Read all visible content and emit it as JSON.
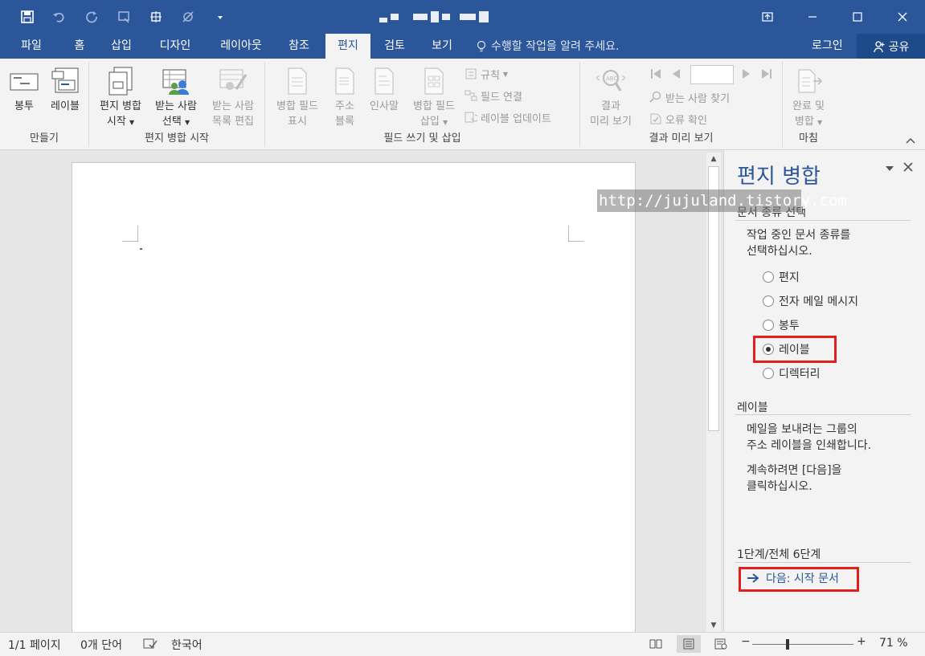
{
  "qat": {
    "icons": [
      "save-icon",
      "undo-icon",
      "redo-icon",
      "customize-icon",
      "print-icon",
      "format-painter-icon",
      "more-icon"
    ]
  },
  "tabs": [
    {
      "label": "파일"
    },
    {
      "label": "홈"
    },
    {
      "label": "삽입"
    },
    {
      "label": "디자인"
    },
    {
      "label": "레이아웃"
    },
    {
      "label": "참조"
    },
    {
      "label": "편지"
    },
    {
      "label": "검토"
    },
    {
      "label": "보기"
    }
  ],
  "tellme": "수행할 작업을 알려 주세요.",
  "login": "로그인",
  "share": "공유",
  "ribbon": {
    "create": {
      "label": "만들기",
      "envelope": "봉투",
      "labels": "레이블"
    },
    "start": {
      "label": "편지 병합 시작",
      "start_merge": [
        "편지 병합",
        "시작"
      ],
      "select_recipients": [
        "받는 사람",
        "선택"
      ],
      "edit_list": [
        "받는 사람",
        "목록 편집"
      ]
    },
    "fields": {
      "label": "필드 쓰기 및 삽입",
      "highlight": [
        "병합 필드",
        "표시"
      ],
      "address": [
        "주소",
        "블록"
      ],
      "greeting": [
        "인사말"
      ],
      "insert_field": [
        "병합 필드",
        "삽입"
      ],
      "rules": "규칙",
      "match": "필드 연결",
      "update": "레이블 업데이트"
    },
    "preview": {
      "label": "결과 미리 보기",
      "preview_btn": [
        "결과",
        "미리 보기"
      ],
      "find": "받는 사람 찾기",
      "check": "오류 확인"
    },
    "finish": {
      "label": "마침",
      "finish_btn": [
        "완료 및",
        "병합"
      ]
    }
  },
  "pane": {
    "title": "편지 병합",
    "watermark": "http://jujuland.tistory.com",
    "section1": "문서 종류 선택",
    "instruction": [
      "작업 중인 문서 종류를",
      "선택하십시오."
    ],
    "options": [
      {
        "label": "편지",
        "selected": false
      },
      {
        "label": "전자 메일 메시지",
        "selected": false
      },
      {
        "label": "봉투",
        "selected": false
      },
      {
        "label": "레이블",
        "selected": true
      },
      {
        "label": "디렉터리",
        "selected": false
      }
    ],
    "section2": "레이블",
    "desc": [
      "메일을 보내려는 그룹의",
      "주소 레이블을 인쇄합니다."
    ],
    "cont": [
      "계속하려면 [다음]을",
      "클릭하십시오."
    ],
    "step": "1단계/전체 6단계",
    "next": "다음: 시작 문서"
  },
  "status": {
    "page": "1/1 페이지",
    "words": "0개 단어",
    "lang": "한국어",
    "zoom": "71 %"
  },
  "colors": {
    "accent": "#2b579a",
    "highlight": "#e0201c"
  }
}
